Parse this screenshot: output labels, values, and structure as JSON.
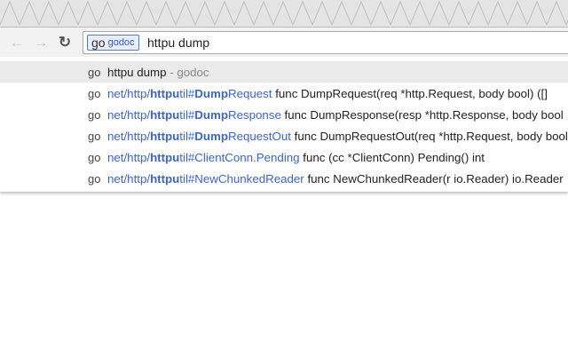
{
  "omnibox": {
    "keyword_icon": "go",
    "keyword": "godoc",
    "query": "httpu dump"
  },
  "toolbar": {
    "back_icon": "arrow-left",
    "forward_icon": "arrow-right",
    "reload_icon": "reload"
  },
  "first": {
    "icon": "go",
    "text": "httpu dump",
    "suffix": "- godoc"
  },
  "suggestions": [
    {
      "icon": "go",
      "p0": "net/http/",
      "b1": "httpu",
      "p2": "til#",
      "b3": "Dump",
      "p4": "Request",
      "desc": "func DumpRequest(req *http.Request, body bool) ([]"
    },
    {
      "icon": "go",
      "p0": "net/http/",
      "b1": "httpu",
      "p2": "til#",
      "b3": "Dump",
      "p4": "Response",
      "desc": "func DumpResponse(resp *http.Response, body bool"
    },
    {
      "icon": "go",
      "p0": "net/http/",
      "b1": "httpu",
      "p2": "til#",
      "b3": "Dump",
      "p4": "RequestOut",
      "desc": "func DumpRequestOut(req *http.Request, body bool"
    },
    {
      "icon": "go",
      "p0": "net/http/",
      "b1": "httpu",
      "p2": "til#ClientConn.Pending",
      "b3": "",
      "p4": "",
      "desc": "func (cc *ClientConn) Pending() int"
    },
    {
      "icon": "go",
      "p0": "net/http/",
      "b1": "httpu",
      "p2": "til#NewChunkedReader",
      "b3": "",
      "p4": "",
      "desc": "func NewChunkedReader(r io.Reader) io.Reader"
    }
  ]
}
